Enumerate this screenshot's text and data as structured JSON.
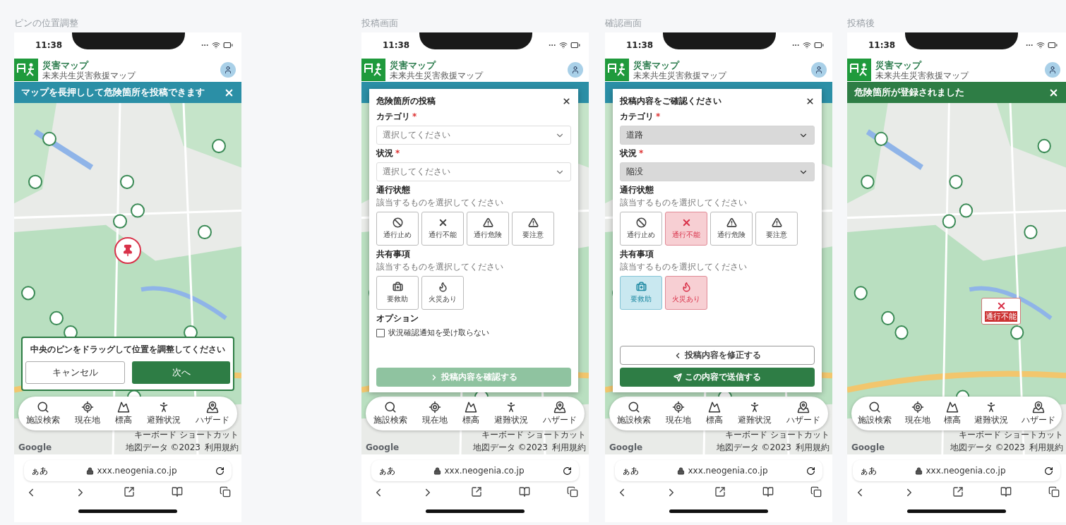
{
  "screens": [
    {
      "caption": "ピンの位置調整",
      "time": "11:38",
      "app_title": "災害マップ",
      "app_subtitle": "未来共生災害救援マップ",
      "banner": {
        "kind": "info",
        "text": "マップを長押しして危険箇所を投稿できます"
      },
      "center_pin": true,
      "pin_dialog": {
        "message": "中央のピンをドラッグして位置を調整してください",
        "cancel": "キャンセル",
        "next": "次へ"
      },
      "nav": [
        {
          "kind": "search",
          "label": "施設検索"
        },
        {
          "kind": "location",
          "label": "現在地"
        },
        {
          "kind": "mountain",
          "label": "標高"
        },
        {
          "kind": "runner",
          "label": "避難状況"
        },
        {
          "kind": "hazard",
          "label": "ハザード"
        }
      ],
      "map_footer": {
        "logo": "Google",
        "links": [
          "キーボード ショートカット",
          "地図データ ©2023",
          "利用規約"
        ]
      },
      "browser": {
        "text_size": "ぁあ",
        "url": "xxx.neogenia.co.jp"
      }
    },
    {
      "caption": "投稿画面",
      "time": "11:38",
      "app_title": "災害マップ",
      "app_subtitle": "未来共生災害救援マップ",
      "banner": {
        "kind": "info"
      },
      "center_pin": false,
      "form": {
        "title": "危険箇所の投稿",
        "fields": [
          {
            "label": "カテゴリ",
            "mark": "*",
            "placeholder": "選択してください",
            "disabled": false
          },
          {
            "label": "状況",
            "mark": "*",
            "placeholder": "選択してください",
            "disabled": false
          }
        ],
        "groups": [
          {
            "label": "通行状態",
            "hint": "該当するものを選択してください",
            "tiles": [
              {
                "label": "通行止め",
                "kind": "stop",
                "selected": false
              },
              {
                "label": "通行不能",
                "kind": "cross",
                "selected": false
              },
              {
                "label": "通行危険",
                "kind": "warning",
                "selected": false
              },
              {
                "label": "要注意",
                "kind": "warning",
                "selected": false
              }
            ]
          },
          {
            "label": "共有事項",
            "hint": "該当するものを選択してください",
            "tiles": [
              {
                "label": "要救助",
                "kind": "rescue",
                "selected": false
              },
              {
                "label": "火災あり",
                "kind": "fire",
                "selected": false
              }
            ]
          }
        ],
        "option": {
          "label": "オプション",
          "checkbox": {
            "label": "状況確認通知を受け取らない",
            "checked": false
          }
        },
        "buttons": [
          {
            "kind": "next",
            "label": "投稿内容を確認する",
            "disabled": true
          }
        ]
      },
      "nav": [
        {
          "kind": "search",
          "label": "施設検索"
        },
        {
          "kind": "location",
          "label": "現在地"
        },
        {
          "kind": "mountain",
          "label": "標高"
        },
        {
          "kind": "runner",
          "label": "避難状況"
        },
        {
          "kind": "hazard",
          "label": "ハザード"
        }
      ],
      "map_footer": {
        "logo": "Google",
        "links": [
          "キーボード ショートカット",
          "地図データ ©2023",
          "利用規約"
        ]
      },
      "browser": {
        "text_size": "ぁあ",
        "url": "xxx.neogenia.co.jp"
      }
    },
    {
      "caption": "確認画面",
      "time": "11:38",
      "app_title": "災害マップ",
      "app_subtitle": "未来共生災害救援マップ",
      "banner": {
        "kind": "info"
      },
      "center_pin": false,
      "form": {
        "title": "投稿内容をご確認ください",
        "fields": [
          {
            "label": "カテゴリ",
            "mark": "*",
            "value": "道路",
            "disabled": true
          },
          {
            "label": "状況",
            "mark": "*",
            "value": "陥没",
            "disabled": true
          }
        ],
        "groups": [
          {
            "label": "通行状態",
            "hint": "該当するものを選択してください",
            "tiles": [
              {
                "label": "通行止め",
                "kind": "stop",
                "selected": false
              },
              {
                "label": "通行不能",
                "kind": "cross",
                "selected": true
              },
              {
                "label": "通行危険",
                "kind": "warning",
                "selected": false
              },
              {
                "label": "要注意",
                "kind": "warning",
                "selected": false
              }
            ]
          },
          {
            "label": "共有事項",
            "hint": "該当するものを選択してください",
            "tiles": [
              {
                "label": "要救助",
                "kind": "rescue",
                "selected": true
              },
              {
                "label": "火災あり",
                "kind": "fire",
                "selected": true
              }
            ]
          }
        ],
        "buttons": [
          {
            "kind": "back",
            "label": "投稿内容を修正する",
            "disabled": false
          },
          {
            "kind": "send",
            "label": "この内容で送信する",
            "disabled": false
          }
        ]
      },
      "nav": [
        {
          "kind": "search",
          "label": "施設検索"
        },
        {
          "kind": "location",
          "label": "現在地"
        },
        {
          "kind": "mountain",
          "label": "標高"
        },
        {
          "kind": "runner",
          "label": "避難状況"
        },
        {
          "kind": "hazard",
          "label": "ハザード"
        }
      ],
      "map_footer": {
        "logo": "Google",
        "links": [
          "キーボード ショートカット",
          "地図データ ©2023",
          "利用規約"
        ]
      },
      "browser": {
        "text_size": "ぁあ",
        "url": "xxx.neogenia.co.jp"
      }
    },
    {
      "caption": "投稿後",
      "time": "11:38",
      "app_title": "災害マップ",
      "app_subtitle": "未来共生災害救援マップ",
      "banner": {
        "kind": "success",
        "text": "危険箇所が登録されました"
      },
      "center_pin": false,
      "markers": [
        {
          "label": "通行不能",
          "kind": "cross"
        }
      ],
      "nav": [
        {
          "kind": "search",
          "label": "施設検索"
        },
        {
          "kind": "location",
          "label": "現在地"
        },
        {
          "kind": "mountain",
          "label": "標高"
        },
        {
          "kind": "runner",
          "label": "避難状況"
        },
        {
          "kind": "hazard",
          "label": "ハザード"
        }
      ],
      "map_footer": {
        "logo": "Google",
        "links": [
          "キーボード ショートカット",
          "地図データ ©2023",
          "利用規約"
        ]
      },
      "browser": {
        "text_size": "ぁあ",
        "url": "xxx.neogenia.co.jp"
      }
    }
  ]
}
